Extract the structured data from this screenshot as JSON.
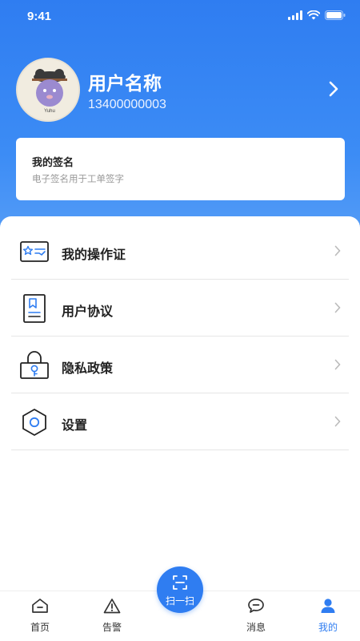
{
  "status_bar": {
    "time": "9:41"
  },
  "profile": {
    "name": "用户名称",
    "phone": "13400000003",
    "avatar_caption": "Yuhu"
  },
  "signature": {
    "title": "我的签名",
    "description": "电子签名用于工单签字"
  },
  "menu": [
    {
      "label": "我的操作证",
      "icon": "certificate-icon"
    },
    {
      "label": "用户协议",
      "icon": "document-icon"
    },
    {
      "label": "隐私政策",
      "icon": "lock-icon"
    },
    {
      "label": "设置",
      "icon": "settings-hexagon-icon"
    }
  ],
  "tabbar": {
    "home": "首页",
    "alarm": "告警",
    "scan": "扫一扫",
    "messages": "消息",
    "mine": "我的"
  },
  "colors": {
    "primary": "#2f7df1",
    "text": "#222222",
    "muted": "#999999"
  }
}
